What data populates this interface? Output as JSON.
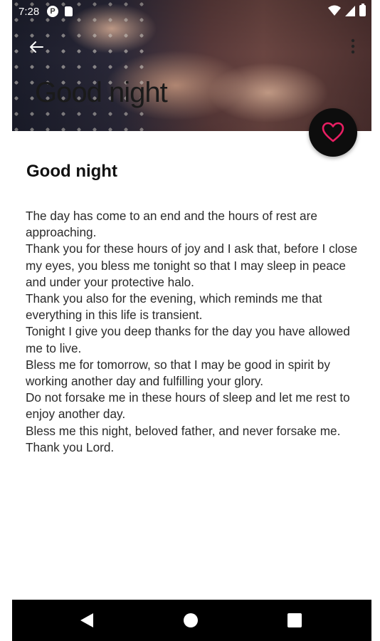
{
  "status_bar": {
    "time": "7:28",
    "icons": [
      "p-icon",
      "sd-card-icon",
      "wifi-icon",
      "signal-icon",
      "battery-icon"
    ]
  },
  "toolbar": {
    "title": "Good night",
    "back_icon": "arrow-left-icon",
    "more_icon": "more-vert-icon"
  },
  "fab": {
    "icon": "heart-outline-icon",
    "icon_color": "#e91e63"
  },
  "content": {
    "title": "Good night",
    "lines": [
      "The day has come to an end and the hours of rest are approaching.",
      "Thank you for these hours of joy and I ask that, before I close my eyes, you bless me tonight so that I may sleep in peace and under your protective halo.",
      "Thank you also for the evening, which reminds me that everything in this life is transient.",
      "Tonight I give you deep thanks for the day you have allowed me to live.",
      "Bless me for tomorrow, so that I may be good in spirit by working another day and fulfilling your glory.",
      "Do not forsake me in these hours of sleep and let me rest to enjoy another day.",
      "Bless me this night, beloved father, and never forsake me.",
      "Thank you Lord."
    ]
  },
  "nav_bar": {
    "icons": [
      "nav-back-icon",
      "nav-home-icon",
      "nav-recents-icon"
    ]
  }
}
